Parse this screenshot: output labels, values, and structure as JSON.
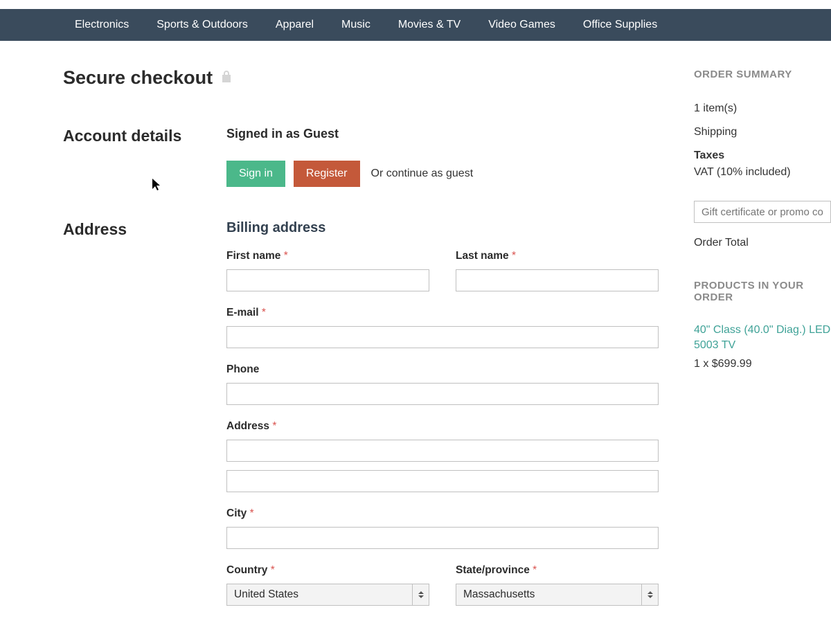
{
  "nav": {
    "items": [
      "Electronics",
      "Sports & Outdoors",
      "Apparel",
      "Music",
      "Movies & TV",
      "Video Games",
      "Office Supplies"
    ]
  },
  "page": {
    "title": "Secure checkout"
  },
  "account": {
    "section_label": "Account details",
    "signed_in": "Signed in as Guest",
    "sign_in": "Sign in",
    "register": "Register",
    "guest_text": "Or continue as guest"
  },
  "address": {
    "section_label": "Address",
    "billing_title": "Billing address",
    "first_name_label": "First name",
    "last_name_label": "Last name",
    "email_label": "E-mail",
    "phone_label": "Phone",
    "address_label": "Address",
    "city_label": "City",
    "country_label": "Country",
    "state_label": "State/province",
    "country_value": "United States",
    "state_value": "Massachusetts"
  },
  "summary": {
    "heading": "ORDER SUMMARY",
    "items": "1 item(s)",
    "shipping": "Shipping",
    "taxes_label": "Taxes",
    "taxes_value": "VAT (10% included)",
    "promo_placeholder": "Gift certificate or promo code",
    "order_total_label": "Order Total"
  },
  "products": {
    "heading": "PRODUCTS IN YOUR ORDER",
    "name": "40\" Class (40.0\" Diag.) LED 5003 TV",
    "qty_price": "1 x $699.99"
  }
}
